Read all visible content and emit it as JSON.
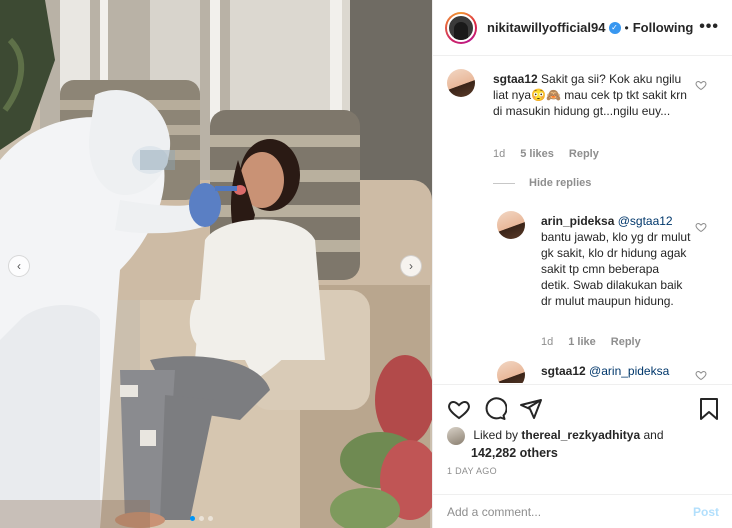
{
  "post": {
    "photo_alt": "",
    "carousel": {
      "prev_icon": "chevron-left-icon",
      "next_icon": "chevron-right-icon",
      "total_slides": 3,
      "active_slide": 1
    }
  },
  "header": {
    "username": "nikitawillyofficial94",
    "verified_icon": "verified-badge-icon",
    "separator": "•",
    "follow_status": "Following",
    "more_icon": "more-options-icon",
    "more_label": "•••"
  },
  "comments": [
    {
      "username": "sgtaa12",
      "text": "Sakit ga sii? Kok aku ngilu liat nya😳🙈 mau cek tp tkt sakit krn di masukin hidung gt...ngilu euy...",
      "age": "1d",
      "likes": "5 likes",
      "reply": "Reply"
    }
  ],
  "hide_replies": "Hide replies",
  "replies": [
    {
      "username": "arin_pideksa",
      "mention": "@sgtaa12",
      "text": "bantu jawab, klo yg dr mulut gk sakit, klo dr hidung agak sakit tp cmn beberapa detik. Swab dilakukan baik dr mulut maupun hidung.",
      "age": "1d",
      "likes": "1 like",
      "reply": "Reply"
    },
    {
      "username": "sgtaa12",
      "mention": "@arin_pideksa",
      "text": ""
    }
  ],
  "actions": {
    "like_icon": "heart-icon",
    "comment_icon": "comment-icon",
    "share_icon": "share-icon",
    "save_icon": "bookmark-icon"
  },
  "likes": {
    "prefix": "Liked by",
    "liker": "thereal_rezkyadhitya",
    "and": "and",
    "others": "142,282 others"
  },
  "timestamp": "1 DAY AGO",
  "add_comment": {
    "placeholder": "Add a comment...",
    "post_label": "Post"
  },
  "colors": {
    "link_blue": "#00376b",
    "post_button_disabled": "#b2dffc",
    "muted": "#8e8e8e",
    "verified": "#3897f0"
  }
}
